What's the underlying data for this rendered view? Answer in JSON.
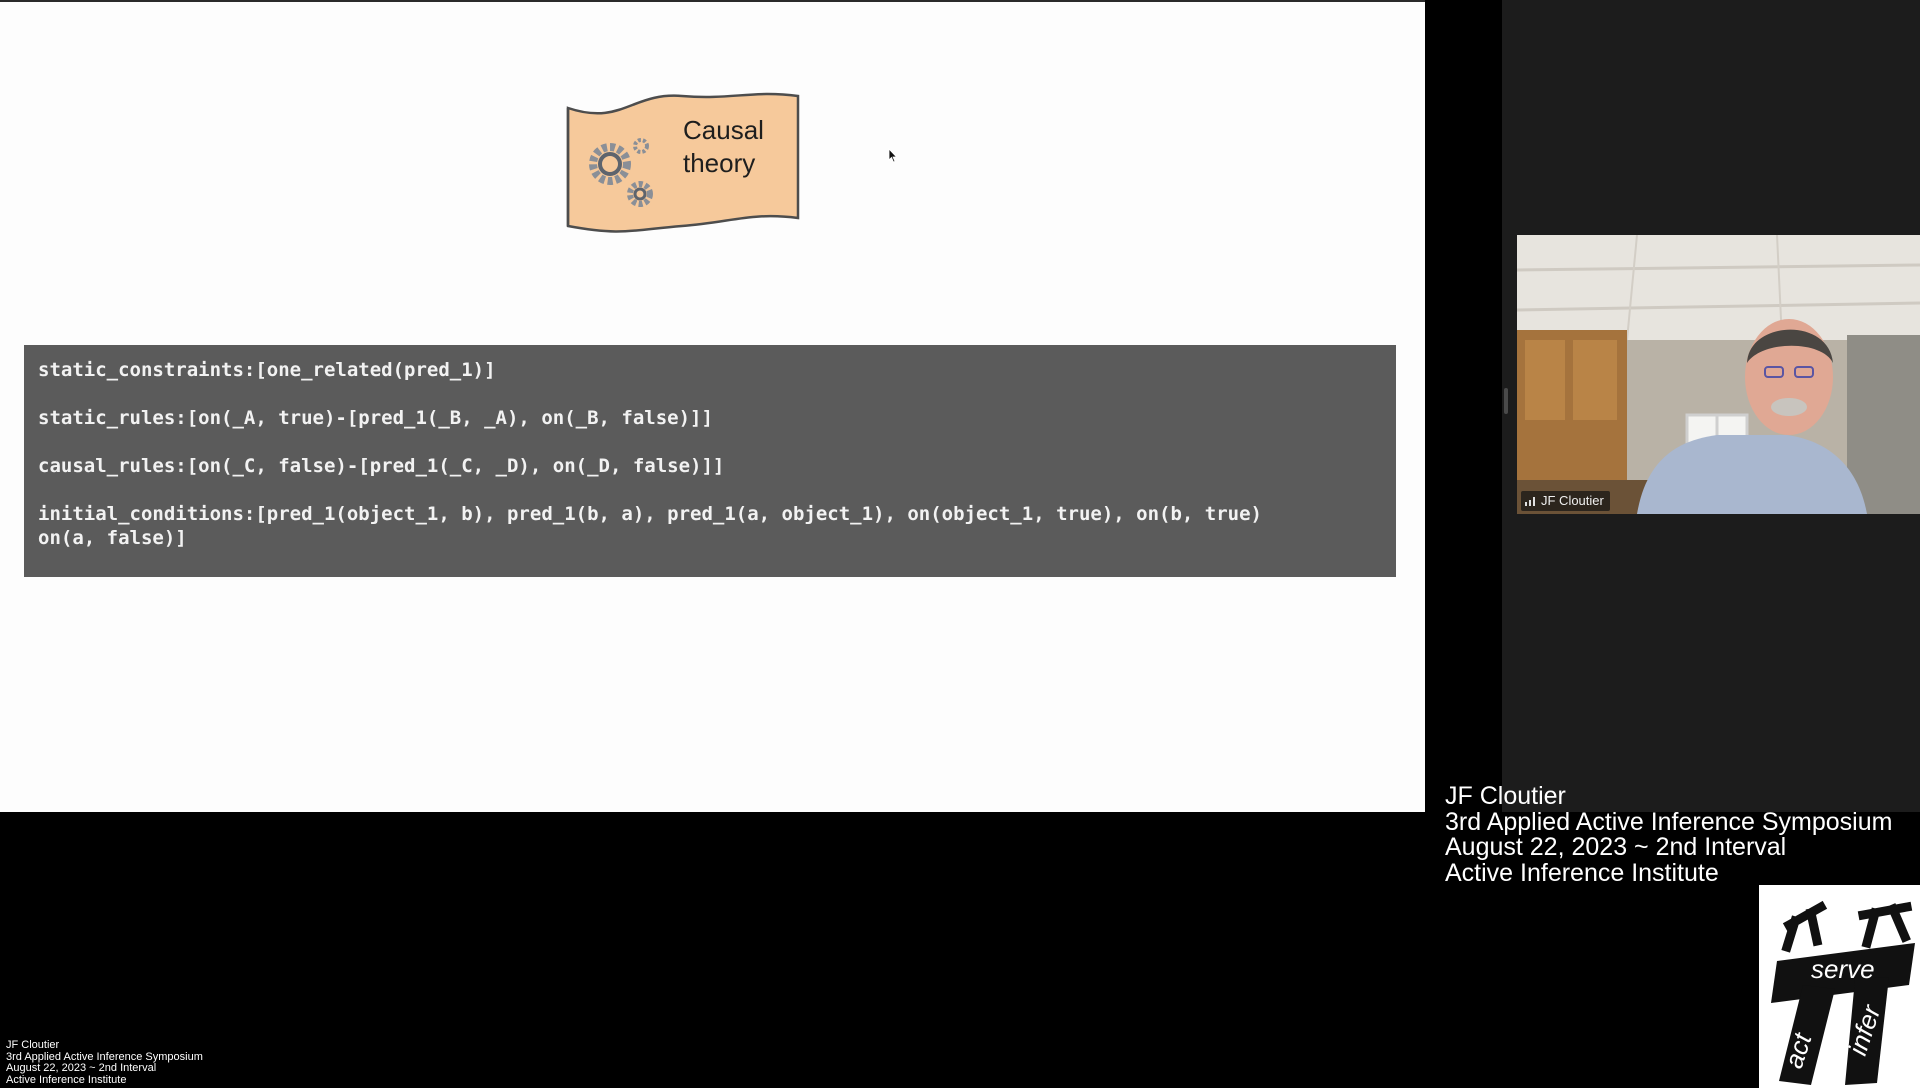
{
  "slide": {
    "scroll_title_line1": "Causal",
    "scroll_title_line2": "theory",
    "code_lines": [
      "static_constraints:[one_related(pred_1)]",
      "static_rules:[on(_A, true)-[pred_1(_B, _A), on(_B, false)]]",
      "causal_rules:[on(_C, false)-[pred_1(_C, _D), on(_D, false)]]",
      "initial_conditions:[pred_1(object_1, b), pred_1(b, a), pred_1(a, object_1), on(object_1, true), on(b, true)\non(a, false)]"
    ]
  },
  "video": {
    "participant_name": "JF Cloutier"
  },
  "caption": {
    "name": "JF Cloutier",
    "event": "3rd Applied Active Inference Symposium",
    "date": "August 22, 2023 ~ 2nd Interval",
    "org": "Active Inference Institute"
  },
  "mini_caption": {
    "name": "JF Cloutier",
    "event": "3rd Applied Active Inference Symposium",
    "date": "August 22, 2023 ~ 2nd Interval",
    "org": "Active Inference Institute"
  },
  "logo": {
    "word_serve": "serve",
    "word_act": "act",
    "word_infer": "infer",
    "icon": "pi-act-infer-logo"
  },
  "colors": {
    "slide_bg": "#fdfdfd",
    "code_bg": "#5b5b5b",
    "scroll_fill": "#f6c99b",
    "gallery_bg": "#1c1c1c"
  }
}
